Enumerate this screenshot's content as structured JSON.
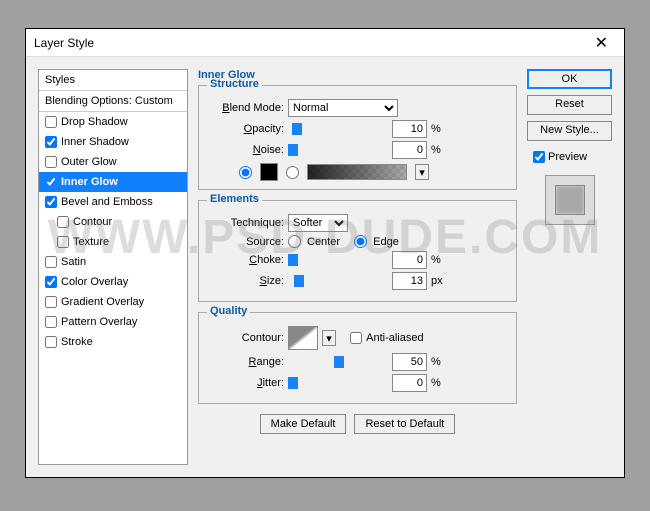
{
  "dialog": {
    "title": "Layer Style"
  },
  "styles": {
    "header": "Styles",
    "blending": "Blending Options: Custom",
    "items": [
      {
        "label": "Drop Shadow",
        "checked": false
      },
      {
        "label": "Inner Shadow",
        "checked": true
      },
      {
        "label": "Outer Glow",
        "checked": false
      },
      {
        "label": "Inner Glow",
        "checked": true,
        "selected": true
      },
      {
        "label": "Bevel and Emboss",
        "checked": true
      },
      {
        "label": "Contour",
        "checked": false,
        "indented": true
      },
      {
        "label": "Texture",
        "checked": false,
        "indented": true
      },
      {
        "label": "Satin",
        "checked": false
      },
      {
        "label": "Color Overlay",
        "checked": true
      },
      {
        "label": "Gradient Overlay",
        "checked": false
      },
      {
        "label": "Pattern Overlay",
        "checked": false
      },
      {
        "label": "Stroke",
        "checked": false
      }
    ]
  },
  "panel": {
    "title": "Inner Glow",
    "structure": {
      "legend": "Structure",
      "blend_mode_label": "Blend Mode:",
      "blend_mode": "Normal",
      "opacity_label": "Opacity:",
      "opacity": "10",
      "opacity_unit": "%",
      "noise_label": "Noise:",
      "noise": "0",
      "noise_unit": "%",
      "color": "#000000"
    },
    "elements": {
      "legend": "Elements",
      "technique_label": "Technique:",
      "technique": "Softer",
      "source_label": "Source:",
      "source_center": "Center",
      "source_edge": "Edge",
      "choke_label": "Choke:",
      "choke": "0",
      "choke_unit": "%",
      "size_label": "Size:",
      "size": "13",
      "size_unit": "px"
    },
    "quality": {
      "legend": "Quality",
      "contour_label": "Contour:",
      "antialias_label": "Anti-aliased",
      "range_label": "Range:",
      "range": "50",
      "range_unit": "%",
      "jitter_label": "Jitter:",
      "jitter": "0",
      "jitter_unit": "%"
    },
    "buttons": {
      "make_default": "Make Default",
      "reset_default": "Reset to Default"
    }
  },
  "right": {
    "ok": "OK",
    "reset": "Reset",
    "new_style": "New Style...",
    "preview": "Preview"
  },
  "watermark": "WWW.PSD-DUDE.COM"
}
